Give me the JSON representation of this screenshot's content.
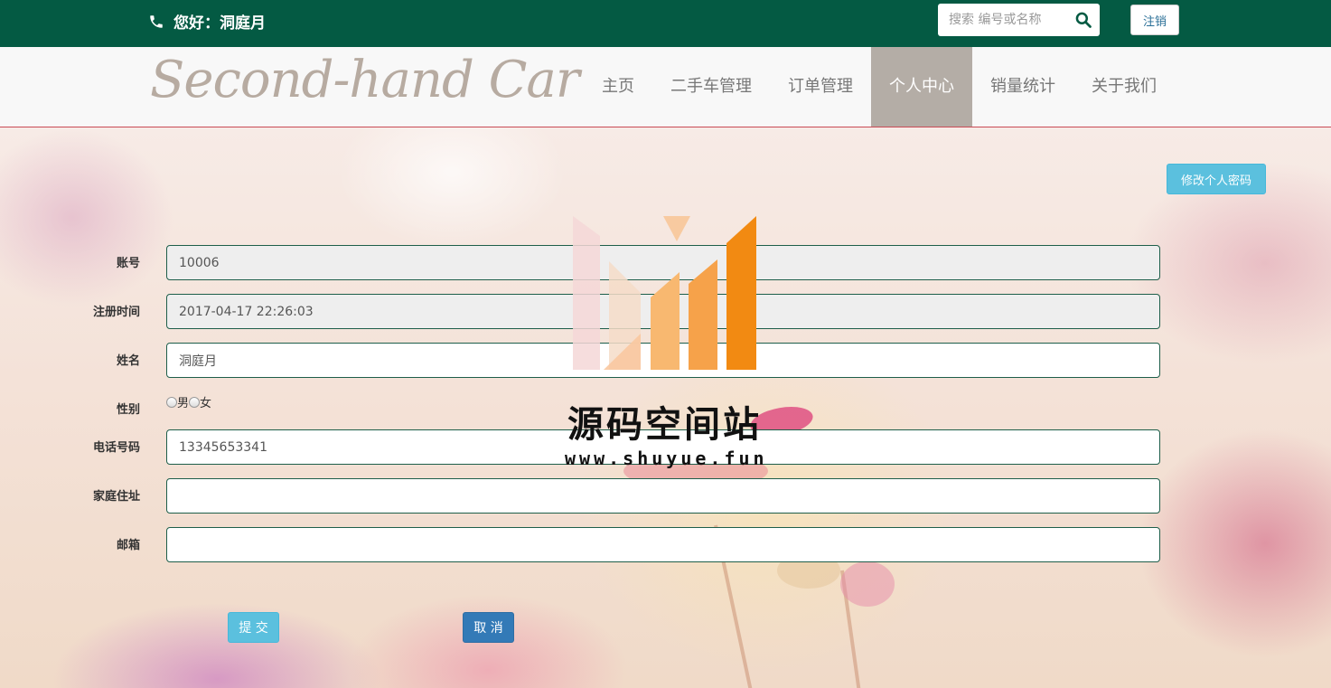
{
  "topbar": {
    "greeting": "您好：洞庭月",
    "search_placeholder": "搜索 编号或名称",
    "logout_label": "注销",
    "bg_color": "#045a43"
  },
  "navbar": {
    "brand": "Second-hand Car",
    "items": [
      {
        "label": "主页",
        "active": false
      },
      {
        "label": "二手车管理",
        "active": false
      },
      {
        "label": "订单管理",
        "active": false
      },
      {
        "label": "个人中心",
        "active": true
      },
      {
        "label": "销量统计",
        "active": false
      },
      {
        "label": "关于我们",
        "active": false
      }
    ]
  },
  "profile": {
    "change_password_label": "修改个人密码",
    "account_label": "账号",
    "account_value": "10006",
    "register_time_label": "注册时间",
    "register_time_value": "2017-04-17 22:26:03",
    "name_label": "姓名",
    "name_value": "洞庭月",
    "gender_label": "性别",
    "gender_male": "男",
    "gender_female": "女",
    "phone_label": "电话号码",
    "phone_value": "13345653341",
    "address_label": "家庭住址",
    "address_value": "",
    "email_label": "邮箱",
    "email_value": "",
    "submit_label": "提 交",
    "cancel_label": "取 消"
  },
  "watermark": {
    "title": "源码空间站",
    "url": "www.shuyue.fun"
  }
}
